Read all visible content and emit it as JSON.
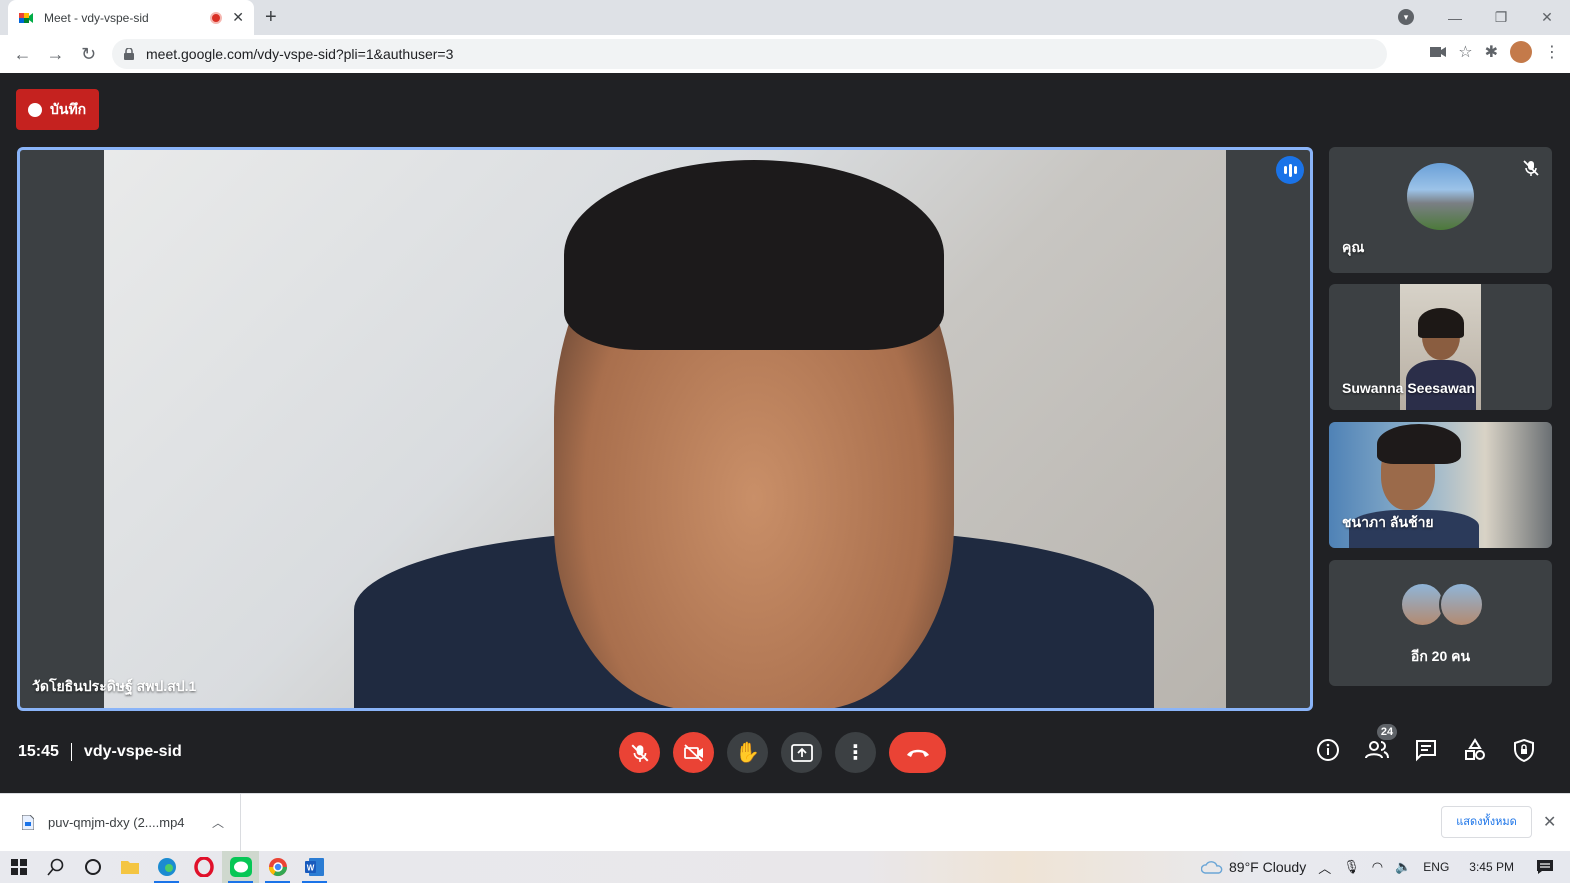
{
  "browser": {
    "tab_title": "Meet - vdy-vspe-sid",
    "tab_close": "✕",
    "new_tab": "+",
    "url": "meet.google.com/vdy-vspe-sid?pli=1&authuser=3",
    "win_min": "—",
    "win_max": "❐",
    "win_close": "✕"
  },
  "meet": {
    "record_label": "บันทึก",
    "main_participant": "วัดโยธินประดิษฐ์ สพป.สป.1",
    "participants": [
      {
        "name": "คุณ",
        "muted": true
      },
      {
        "name": "Suwanna Seesawan"
      },
      {
        "name": "ชนาภา ลันช้าย"
      }
    ],
    "more_label": "อีก 20 คน",
    "time": "15:45",
    "meeting_code": "vdy-vspe-sid",
    "people_count": "24",
    "colors": {
      "accent": "#8ab4f8",
      "danger": "#ea4335",
      "record": "#c5221f"
    }
  },
  "downloads": {
    "file_name": "puv-qmjm-dxy (2....mp4",
    "show_all": "แสดงทั้งหมด",
    "close": "✕"
  },
  "taskbar": {
    "weather": "89°F  Cloudy",
    "lang": "ENG",
    "clock": "3:45 PM"
  }
}
